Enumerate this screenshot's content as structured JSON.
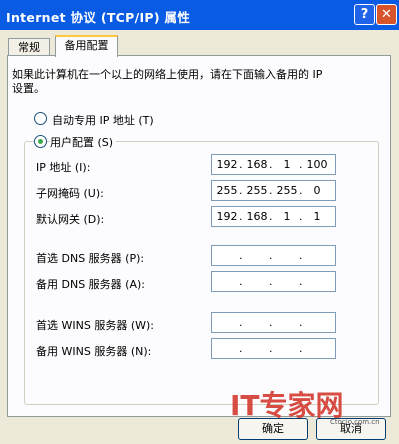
{
  "window": {
    "title": "Internet 协议 (TCP/IP) 属性",
    "help": "?",
    "close": "✕"
  },
  "tabs": [
    {
      "label": "常规"
    },
    {
      "label": "备用配置"
    }
  ],
  "intro_line1": "如果此计算机在一个以上的网络上使用，请在下面输入备用的 IP",
  "intro_line2": "设置。",
  "options": {
    "auto": "自动专用 IP 地址 (T)",
    "user": "用户配置 (S)"
  },
  "fields": {
    "ip": {
      "label": "IP 地址 (I):",
      "octets": [
        "192",
        "168",
        "1",
        "100"
      ]
    },
    "mask": {
      "label": "子网掩码 (U):",
      "octets": [
        "255",
        "255",
        "255",
        "0"
      ]
    },
    "gateway": {
      "label": "默认网关 (D):",
      "octets": [
        "192",
        "168",
        "1",
        "1"
      ]
    },
    "dns1": {
      "label": "首选 DNS 服务器 (P):",
      "octets": [
        "",
        "",
        "",
        ""
      ]
    },
    "dns2": {
      "label": "备用 DNS 服务器 (A):",
      "octets": [
        "",
        "",
        "",
        ""
      ]
    },
    "wins1": {
      "label": "首选 WINS 服务器 (W):",
      "octets": [
        "",
        "",
        "",
        ""
      ]
    },
    "wins2": {
      "label": "备用 WINS 服务器 (N):",
      "octets": [
        "",
        "",
        "",
        ""
      ]
    }
  },
  "buttons": {
    "ok": "确定",
    "cancel": "取消"
  },
  "watermark": {
    "brand": "IT专家网",
    "url": "Ctocio.com.cn"
  }
}
